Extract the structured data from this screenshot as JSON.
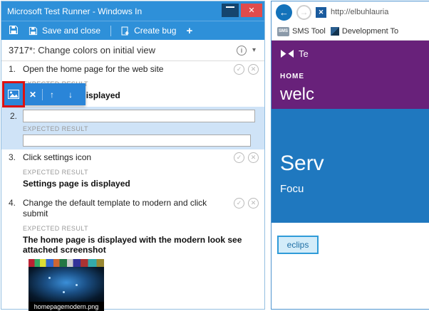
{
  "icons": {
    "pass": "✓",
    "fail": "✕",
    "close": "✕",
    "delete": "✕",
    "up": "↑",
    "down": "↓",
    "back": "←",
    "forward": "→",
    "info": "i",
    "caret": "▾",
    "plus": "+"
  },
  "test_runner": {
    "window_title": "Microsoft Test Runner - Windows In",
    "toolbar": {
      "save_and_close": "Save and close",
      "create_bug": "Create bug"
    },
    "header_title": "3717*: Change colors on initial view",
    "expected_label": "EXPECTED RESULT",
    "steps": {
      "s1": {
        "num": "1.",
        "title": "Open the home page for the web site",
        "expected": "Home page is displayed"
      },
      "s2": {
        "num": "2.",
        "action_value": "",
        "expected_value": ""
      },
      "s3": {
        "num": "3.",
        "title": "Click settings icon",
        "expected": "Settings page is displayed"
      },
      "s4": {
        "num": "4.",
        "title": "Change the default template to modern and click submit",
        "expected": "The home page is displayed with the modern look see attached screenshot",
        "attachment": "homepagemodern.png"
      }
    }
  },
  "browser": {
    "url": "http://elbuhlauria",
    "favorites": [
      {
        "icon_text": "SMS",
        "label": "SMS Tool"
      },
      {
        "label": "Development To"
      }
    ],
    "page": {
      "brand": "Te",
      "nav_home": "HOME",
      "welcome": "welc",
      "hero_title": "Serv",
      "hero_subtitle": "Focu",
      "eclipse_button": "eclips"
    }
  },
  "colors": {
    "titlebar_blue": "#2e90d9",
    "close_red": "#e14b4b",
    "selected_step_bg": "#cfe3f7",
    "site_purple": "#68217a",
    "site_blue": "#1f78bf",
    "highlight_red": "#dd1111"
  }
}
